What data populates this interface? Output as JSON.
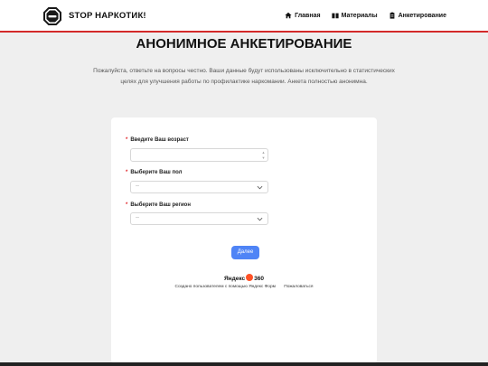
{
  "header": {
    "brand": "STOP НАРКОТИК!",
    "nav": [
      {
        "label": "Главная",
        "icon": "home-icon"
      },
      {
        "label": "Материалы",
        "icon": "book-icon"
      },
      {
        "label": "Анкетирование",
        "icon": "clipboard-icon"
      }
    ]
  },
  "page": {
    "title": "АНОНИМНОЕ АНКЕТИРОВАНИЕ",
    "subtitle": "Пожалуйста, ответьте на вопросы честно. Ваши данные будут использованы исключительно в статистических целях для улучшения работы по профилактике наркомании. Анкета полностью анонимна."
  },
  "form": {
    "fields": [
      {
        "label": "Введите Ваш возраст",
        "value": ""
      },
      {
        "label": "Выберите Ваш пол",
        "value": "--"
      },
      {
        "label": "Выберите Ваш регион",
        "value": "--"
      }
    ],
    "required_mark": "*",
    "submit_label": "Далее",
    "yandex_left": "Яндекс",
    "yandex_right": "360",
    "created_by": "Создано пользователем с помощью Яндекс Форм",
    "report": "Пожаловаться"
  },
  "colors": {
    "accent": "#d32a2a",
    "button": "#4f84f6",
    "yandex": "#ff5226"
  }
}
